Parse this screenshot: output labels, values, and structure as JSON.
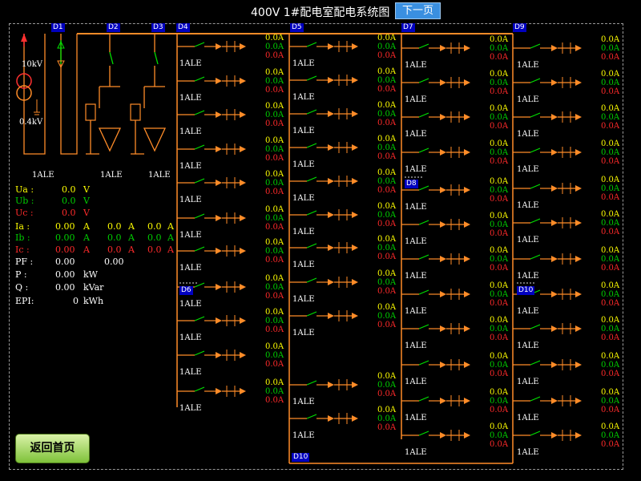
{
  "header": {
    "title": "400V 1#配电室配电系统图",
    "next_label": "下一页"
  },
  "footer": {
    "home_label": "返回首页"
  },
  "colors": {
    "bus": "#ff8c28",
    "switch_blade": "#00e000",
    "tag_bg": "#0000c0",
    "voltage": "#ffff00",
    "phase_a": "#00d000",
    "phase_c": "#ff2a2a"
  },
  "incoming": {
    "hv_label": "10kV",
    "lv_label": "0.4kV",
    "cabinet_labels": [
      "1ALE",
      "1ALE",
      "1ALE"
    ]
  },
  "panels": [
    {
      "id": "D1"
    },
    {
      "id": "D2"
    },
    {
      "id": "D3"
    },
    {
      "id": "D4"
    },
    {
      "id": "D5"
    },
    {
      "id": "D6"
    },
    {
      "id": "D7"
    },
    {
      "id": "D8"
    },
    {
      "id": "D9"
    },
    {
      "id": "D10"
    },
    {
      "id": "D10"
    }
  ],
  "feeder_label": "1ALE",
  "feeder_reading": {
    "a": "0.0A",
    "b": "0.0A",
    "c": "0.0A"
  },
  "measurements": {
    "ua": {
      "label": "Ua :",
      "value": "0.0",
      "unit": "V"
    },
    "ub": {
      "label": "Ub :",
      "value": "0.0",
      "unit": "V"
    },
    "uc": {
      "label": "Uc :",
      "value": "0.0",
      "unit": "V"
    },
    "ia": {
      "label": "Ia :",
      "values": [
        "0.00",
        "0.0",
        "0.0"
      ],
      "unit": "A"
    },
    "ib": {
      "label": "Ib :",
      "values": [
        "0.00",
        "0.0",
        "0.0"
      ],
      "unit": "A"
    },
    "ic": {
      "label": "Ic :",
      "values": [
        "0.00",
        "0.0",
        "0.0"
      ],
      "unit": "A"
    },
    "pf": {
      "label": "PF :",
      "values": [
        "0.00",
        "0.00"
      ]
    },
    "p": {
      "label": "P  :",
      "value": "0.00",
      "unit": "kW"
    },
    "q": {
      "label": "Q  :",
      "value": "0.00",
      "unit": "kVar"
    },
    "epi": {
      "label": "EPI:",
      "value": "0",
      "unit": "kWh"
    }
  }
}
